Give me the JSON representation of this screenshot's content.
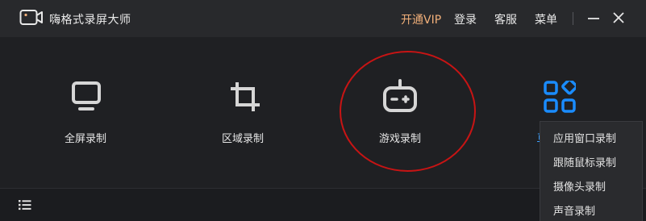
{
  "app": {
    "title": "嗨格式录屏大师"
  },
  "header": {
    "vip_label": "开通VIP",
    "login_label": "登录",
    "service_label": "客服",
    "menu_label": "菜单"
  },
  "tools": [
    {
      "label": "全屏录制",
      "icon": "monitor-icon"
    },
    {
      "label": "区域录制",
      "icon": "crop-icon"
    },
    {
      "label": "游戏录制",
      "icon": "gamepad-icon"
    },
    {
      "label": "更多",
      "icon": "apps-grid-icon"
    }
  ],
  "dropdown": {
    "items": [
      "应用窗口录制",
      "跟随鼠标录制",
      "摄像头录制",
      "声音录制"
    ]
  },
  "colors": {
    "accent_blue": "#1a8cff",
    "vip_orange": "#f2b07a",
    "highlight_red": "#c81414"
  }
}
